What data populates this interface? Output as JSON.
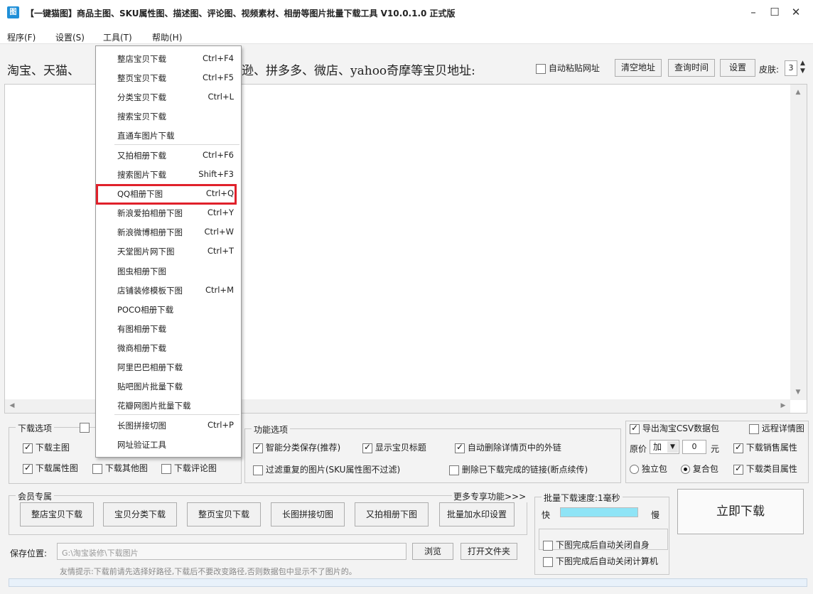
{
  "window": {
    "title": "【一键猫图】商品主图、SKU属性图、描述图、评论图、视频素材、相册等图片批量下载工具 V10.0.1.0 正式版",
    "minimize": "–",
    "maximize": "☐",
    "close": "✕"
  },
  "menubar": {
    "items": [
      "程序(F)",
      "设置(S)",
      "工具(T)",
      "帮助(H)"
    ]
  },
  "urlrow": {
    "label_left": "淘宝、天猫、",
    "label_right": "逊、拼多多、微店、yahoo奇摩等宝贝地址:",
    "auto_paste": "自动粘贴网址",
    "clear_btn": "清空地址",
    "query_btn": "查询时间",
    "settings_btn": "设置",
    "skin_label": "皮肤:",
    "skin_value": "3"
  },
  "tools_menu": {
    "items": [
      {
        "label": "整店宝贝下载",
        "shortcut": "Ctrl+F4"
      },
      {
        "label": "整页宝贝下载",
        "shortcut": "Ctrl+F5"
      },
      {
        "label": "分类宝贝下载",
        "shortcut": "Ctrl+L"
      },
      {
        "label": "搜索宝贝下载",
        "shortcut": ""
      },
      {
        "label": "直通车图片下载",
        "shortcut": ""
      },
      {
        "label": "又拍相册下载",
        "shortcut": "Ctrl+F6"
      },
      {
        "label": "搜索图片下载",
        "shortcut": "Shift+F3"
      },
      {
        "label": "QQ相册下图",
        "shortcut": "Ctrl+Q"
      },
      {
        "label": "新浪爱拍相册下图",
        "shortcut": "Ctrl+Y"
      },
      {
        "label": "新浪微博相册下图",
        "shortcut": "Ctrl+W"
      },
      {
        "label": "天堂图片网下图",
        "shortcut": "Ctrl+T"
      },
      {
        "label": "图虫相册下图",
        "shortcut": ""
      },
      {
        "label": "店铺装修模板下图",
        "shortcut": "Ctrl+M"
      },
      {
        "label": "POCO相册下载",
        "shortcut": ""
      },
      {
        "label": "有图相册下载",
        "shortcut": ""
      },
      {
        "label": "微商相册下载",
        "shortcut": ""
      },
      {
        "label": "阿里巴巴相册下载",
        "shortcut": ""
      },
      {
        "label": "贴吧图片批量下载",
        "shortcut": ""
      },
      {
        "label": "花瓣网图片批量下载",
        "shortcut": ""
      },
      {
        "label": "长图拼接切图",
        "shortcut": "Ctrl+P"
      },
      {
        "label": "网址验证工具",
        "shortcut": ""
      }
    ]
  },
  "download_options": {
    "title": "下载选项",
    "main_img": "下载主图",
    "attr_img": "下载属性图",
    "other_img": "下载其他图",
    "comment_img": "下载评论图"
  },
  "function_options": {
    "title": "功能选项",
    "smart_save": "智能分类保存(推荐)",
    "show_title": "显示宝贝标题",
    "auto_remove_links": "自动删除详情页中的外链",
    "filter_dup": "过滤重复的图片(SKU属性图不过滤)",
    "delete_done": "删除已下载完成的链接(断点续传)"
  },
  "right_options": {
    "export_csv": "导出淘宝CSV数据包",
    "remote_detail": "远程详情图",
    "price_label": "原价",
    "price_op": "加",
    "price_value": "0",
    "price_unit": "元",
    "sales_attr": "下载销售属性",
    "single_pkg": "独立包",
    "combo_pkg": "复合包",
    "category_attr": "下载类目属性"
  },
  "member": {
    "title": "会员专属",
    "more": "更多专享功能>>>",
    "buttons": [
      "整店宝贝下载",
      "宝贝分类下载",
      "整页宝贝下载",
      "长图拼接切图",
      "又拍相册下图",
      "批量加水印设置"
    ]
  },
  "speed": {
    "label": "批量下载速度:1毫秒",
    "fast": "快",
    "slow": "慢",
    "level": 1.0
  },
  "download_btn": "立即下载",
  "after_done": {
    "close_self": "下图完成后自动关闭自身",
    "shutdown": "下图完成后自动关闭计算机"
  },
  "save": {
    "label": "保存位置:",
    "path": "G:\\淘宝装修\\下载图片",
    "browse": "浏览",
    "open_folder": "打开文件夹",
    "tip": "友情提示:下载前请先选择好路径,下载后不要改变路径,否则数据包中显示不了图片的。"
  }
}
